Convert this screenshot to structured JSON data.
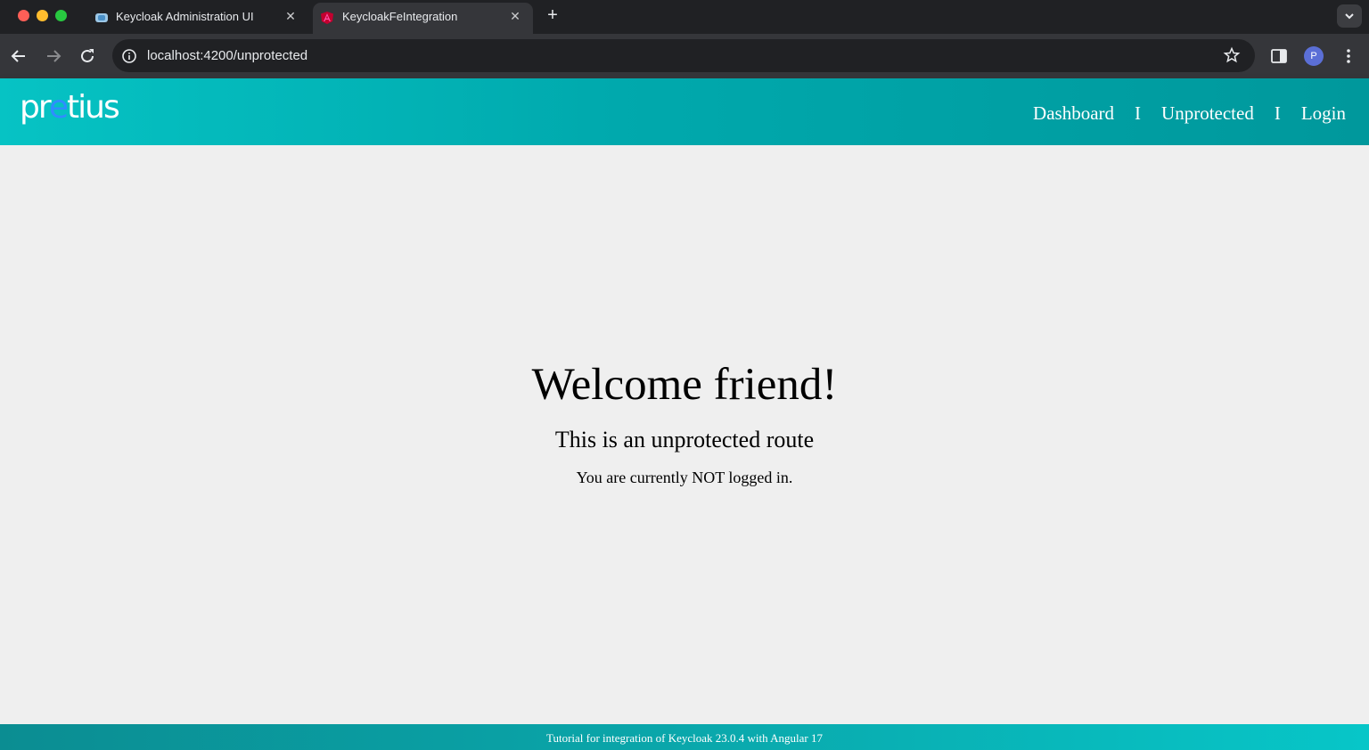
{
  "browser": {
    "tabs": [
      {
        "title": "Keycloak Administration UI",
        "favicon": "keycloak-icon",
        "active": false
      },
      {
        "title": "KeycloakFeIntegration",
        "favicon": "angular-icon",
        "active": true
      }
    ],
    "url": "localhost:4200/unprotected",
    "profile_initial": "P"
  },
  "header": {
    "logo_prefix": "pr",
    "logo_accent": "e",
    "logo_suffix": "tius",
    "nav": {
      "dashboard": "Dashboard",
      "separator": "I",
      "unprotected": "Unprotected",
      "login": "Login"
    }
  },
  "main": {
    "heading": "Welcome friend!",
    "subheading": "This is an unprotected route",
    "status": "You are currently NOT logged in."
  },
  "footer": {
    "text": "Tutorial for integration of Keycloak 23.0.4 with Angular 17"
  },
  "colors": {
    "header_start": "#06c3c4",
    "header_end": "#00989c",
    "logo_accent": "#2f8dff",
    "page_bg": "#efefef"
  }
}
